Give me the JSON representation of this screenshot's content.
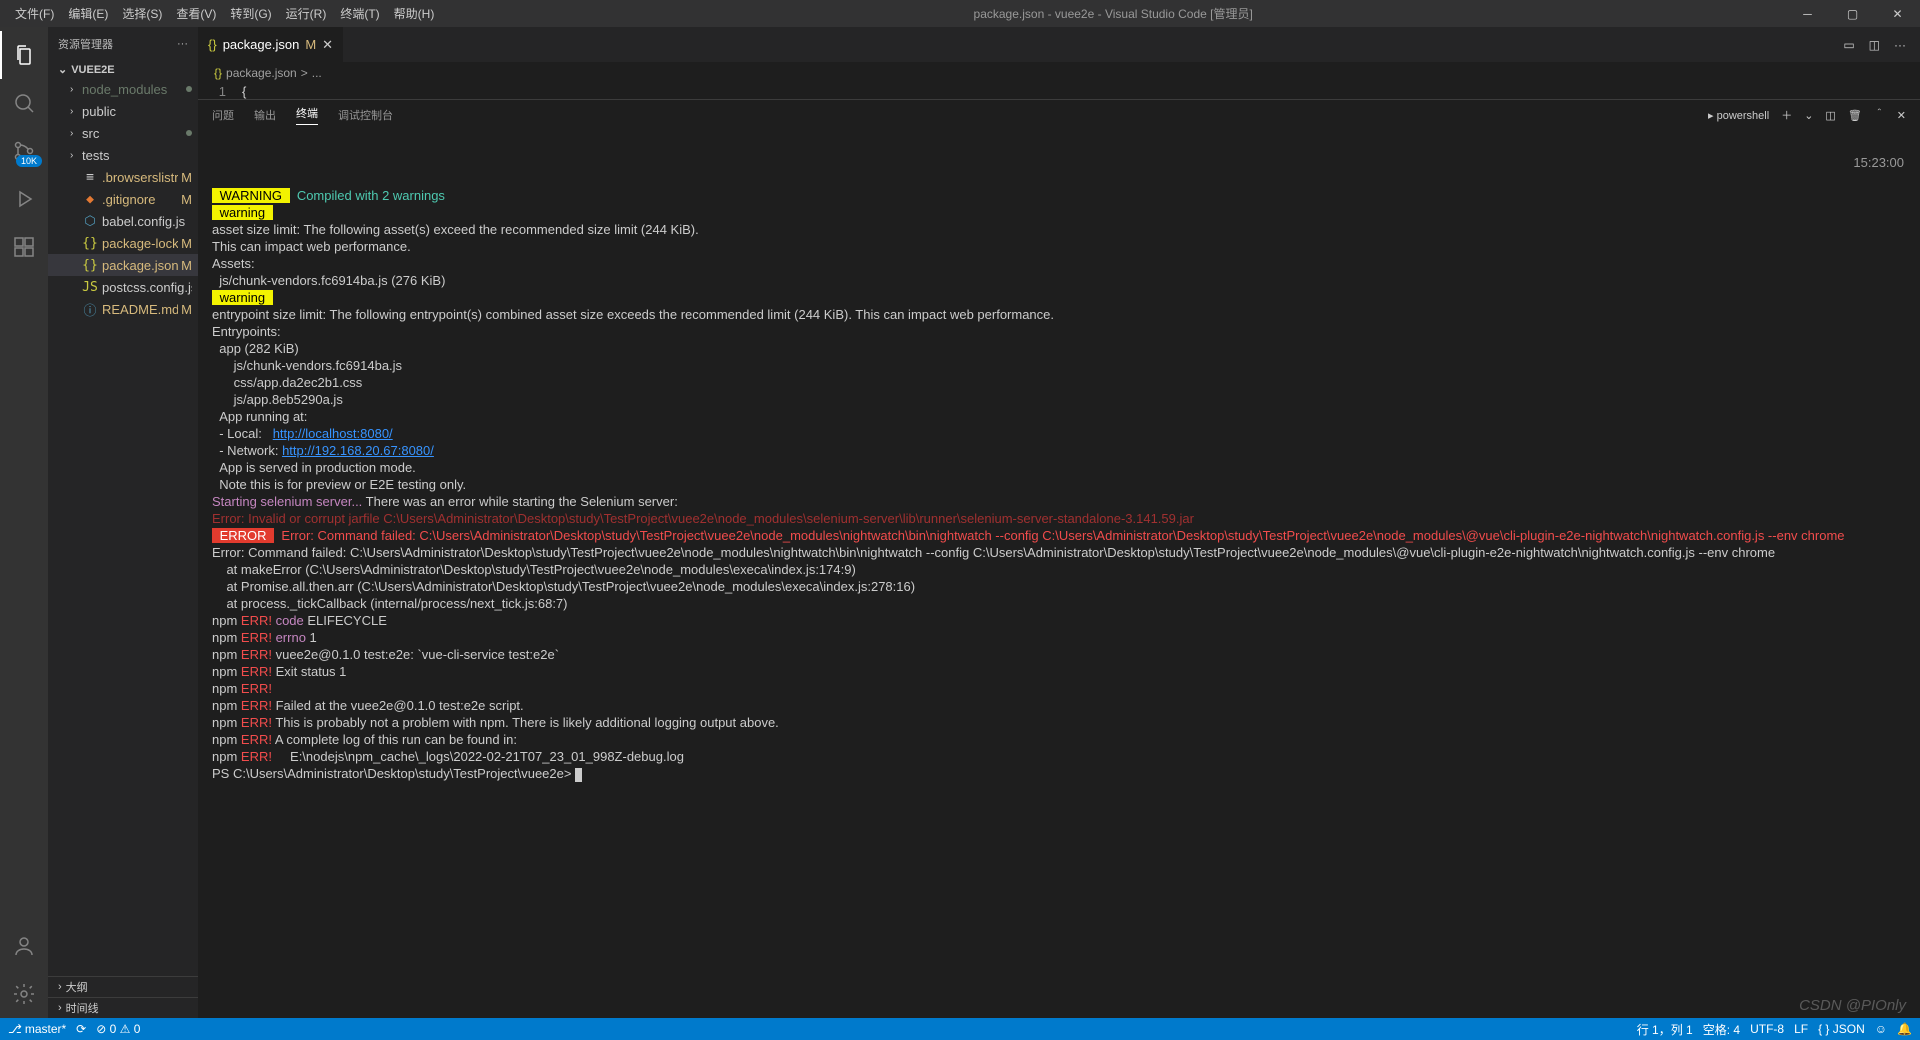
{
  "titlebar": {
    "menus": [
      "文件(F)",
      "编辑(E)",
      "选择(S)",
      "查看(V)",
      "转到(G)",
      "运行(R)",
      "终端(T)",
      "帮助(H)"
    ],
    "title": "package.json - vuee2e - Visual Studio Code [管理员]"
  },
  "sidebar": {
    "head": "资源管理器",
    "root": "VUEE2E",
    "items": [
      {
        "label": "node_modules",
        "kind": "folder",
        "dim": true,
        "dot": true
      },
      {
        "label": "public",
        "kind": "folder"
      },
      {
        "label": "src",
        "kind": "folder",
        "dot": true
      },
      {
        "label": "tests",
        "kind": "folder"
      },
      {
        "label": ".browserslistrc",
        "kind": "file",
        "icon": "≡",
        "status": "M",
        "mod": true
      },
      {
        "label": ".gitignore",
        "kind": "file",
        "icon": "◆",
        "status": "M",
        "mod": true,
        "iconColor": "#e37933"
      },
      {
        "label": "babel.config.js",
        "kind": "file",
        "icon": "⬡",
        "iconColor": "#519aba"
      },
      {
        "label": "package-lock.json",
        "kind": "file",
        "icon": "{}",
        "status": "M",
        "mod": true,
        "iconColor": "#cbcb41"
      },
      {
        "label": "package.json",
        "kind": "file",
        "icon": "{}",
        "status": "M",
        "mod": true,
        "selected": true,
        "iconColor": "#cbcb41"
      },
      {
        "label": "postcss.config.js",
        "kind": "file",
        "icon": "JS",
        "iconColor": "#cbcb41"
      },
      {
        "label": "README.md",
        "kind": "file",
        "icon": "ⓘ",
        "status": "M",
        "mod": true,
        "iconColor": "#519aba"
      }
    ],
    "footer": [
      "大纲",
      "时间线"
    ]
  },
  "scm_badge": "10K",
  "tab": {
    "icon": "{}",
    "label": "package.json",
    "status": "M"
  },
  "breadcrumb": {
    "icon": "{}",
    "file": "package.json",
    "sep": ">",
    "more": "..."
  },
  "code": {
    "ln": "1",
    "txt": "{"
  },
  "panel": {
    "tabs": [
      "问题",
      "输出",
      "终端",
      "调试控制台"
    ],
    "active": 2,
    "shell": "powershell"
  },
  "terminal": {
    "timestamp": "15:23:00",
    "warning_tag": "WARNING",
    "compiled": "Compiled with 2 warnings",
    "warn_label": "warning",
    "asset_block": "asset size limit: The following asset(s) exceed the recommended size limit (244 KiB).\nThis can impact web performance.\nAssets:\n  js/chunk-vendors.fc6914ba.js (276 KiB)",
    "entry_block": "entrypoint size limit: The following entrypoint(s) combined asset size exceeds the recommended limit (244 KiB). This can impact web performance.\nEntrypoints:\n  app (282 KiB)\n      js/chunk-vendors.fc6914ba.js\n      css/app.da2ec2b1.css\n      js/app.8eb5290a.js",
    "running_at": "  App running at:",
    "local_lbl": "  - Local:   ",
    "local_url": "http://localhost:8080/",
    "net_lbl": "  - Network: ",
    "net_url": "http://192.168.20.67:8080/",
    "prod1": "  App is served in production mode.",
    "prod2": "  Note this is for preview or E2E testing only.",
    "sel_start": "Starting selenium server...",
    "sel_err": " There was an error while starting the Selenium server:",
    "jar_err": "Error: Invalid or corrupt jarfile C:\\Users\\Administrator\\Desktop\\study\\TestProject\\vuee2e\\node_modules\\selenium-server\\lib\\runner\\selenium-server-standalone-3.141.59.jar",
    "error_tag": "ERROR",
    "err_cmd": "Error: Command failed: C:\\Users\\Administrator\\Desktop\\study\\TestProject\\vuee2e\\node_modules\\nightwatch\\bin\\nightwatch --config C:\\Users\\Administrator\\Desktop\\study\\TestProject\\vuee2e\\node_modules\\@vue\\cli-plugin-e2e-nightwatch\\nightwatch.config.js --env chrome",
    "stack": "Error: Command failed: C:\\Users\\Administrator\\Desktop\\study\\TestProject\\vuee2e\\node_modules\\nightwatch\\bin\\nightwatch --config C:\\Users\\Administrator\\Desktop\\study\\TestProject\\vuee2e\\node_modules\\@vue\\cli-plugin-e2e-nightwatch\\nightwatch.config.js --env chrome\n    at makeError (C:\\Users\\Administrator\\Desktop\\study\\TestProject\\vuee2e\\node_modules\\execa\\index.js:174:9)\n    at Promise.all.then.arr (C:\\Users\\Administrator\\Desktop\\study\\TestProject\\vuee2e\\node_modules\\execa\\index.js:278:16)\n    at process._tickCallback (internal/process/next_tick.js:68:7)",
    "npm_lines": [
      {
        "pre": "npm ",
        "err": "ERR!",
        "mid": " code ",
        "rest": "ELIFECYCLE"
      },
      {
        "pre": "npm ",
        "err": "ERR!",
        "mid": " errno ",
        "rest": "1"
      },
      {
        "pre": "npm ",
        "err": "ERR!",
        "mid": " ",
        "rest": "vuee2e@0.1.0 test:e2e: `vue-cli-service test:e2e`"
      },
      {
        "pre": "npm ",
        "err": "ERR!",
        "mid": " ",
        "rest": "Exit status 1"
      },
      {
        "pre": "npm ",
        "err": "ERR!",
        "mid": "",
        "rest": ""
      },
      {
        "pre": "npm ",
        "err": "ERR!",
        "mid": " ",
        "rest": "Failed at the vuee2e@0.1.0 test:e2e script."
      },
      {
        "pre": "npm ",
        "err": "ERR!",
        "mid": " ",
        "rest": "This is probably not a problem with npm. There is likely additional logging output above."
      }
    ],
    "npm_log1": {
      "pre": "npm ",
      "err": "ERR!",
      "rest": " A complete log of this run can be found in:"
    },
    "npm_log2": {
      "pre": "npm ",
      "err": "ERR!",
      "rest": "     E:\\nodejs\\npm_cache\\_logs\\2022-02-21T07_23_01_998Z-debug.log"
    },
    "prompt": "PS C:\\Users\\Administrator\\Desktop\\study\\TestProject\\vuee2e> "
  },
  "statusbar": {
    "branch": "master*",
    "sync": "⟳",
    "errs": "⊘ 0 ⚠ 0",
    "pos": "行 1，列 1",
    "spaces": "空格: 4",
    "enc": "UTF-8",
    "eol": "LF",
    "lang": "{ } JSON",
    "bell": "🔔"
  },
  "watermark": "CSDN @PIOnly"
}
